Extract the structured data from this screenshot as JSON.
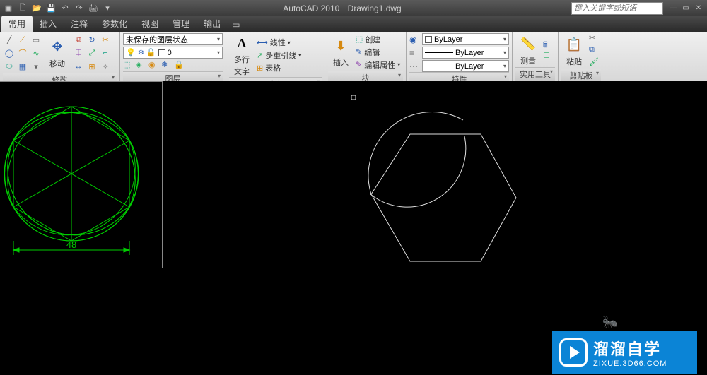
{
  "title": {
    "app": "AutoCAD 2010",
    "file": "Drawing1.dwg"
  },
  "search": {
    "placeholder": "键入关键字或短语"
  },
  "tabs": [
    "常用",
    "插入",
    "注释",
    "参数化",
    "视图",
    "管理",
    "输出"
  ],
  "panels": {
    "modify": {
      "label": "修改",
      "move": "移动"
    },
    "layer": {
      "label": "图层",
      "state": "未保存的图层状态"
    },
    "annot": {
      "label": "注释",
      "mtext1": "多行",
      "mtext2": "文字",
      "linear": "线性",
      "leader": "多重引线",
      "table": "表格"
    },
    "block": {
      "label": "块",
      "insert": "插入",
      "create": "创建",
      "edit": "编辑",
      "attr": "编辑属性"
    },
    "prop": {
      "label": "特性",
      "bylayer": "ByLayer"
    },
    "util": {
      "label": "实用工具",
      "measure": "测量"
    },
    "clip": {
      "label": "剪贴板",
      "paste": "粘贴"
    }
  },
  "drawing": {
    "dimension": "48"
  },
  "watermark": {
    "main": "溜溜自学",
    "sub": "ZIXUE.3D66.COM"
  }
}
